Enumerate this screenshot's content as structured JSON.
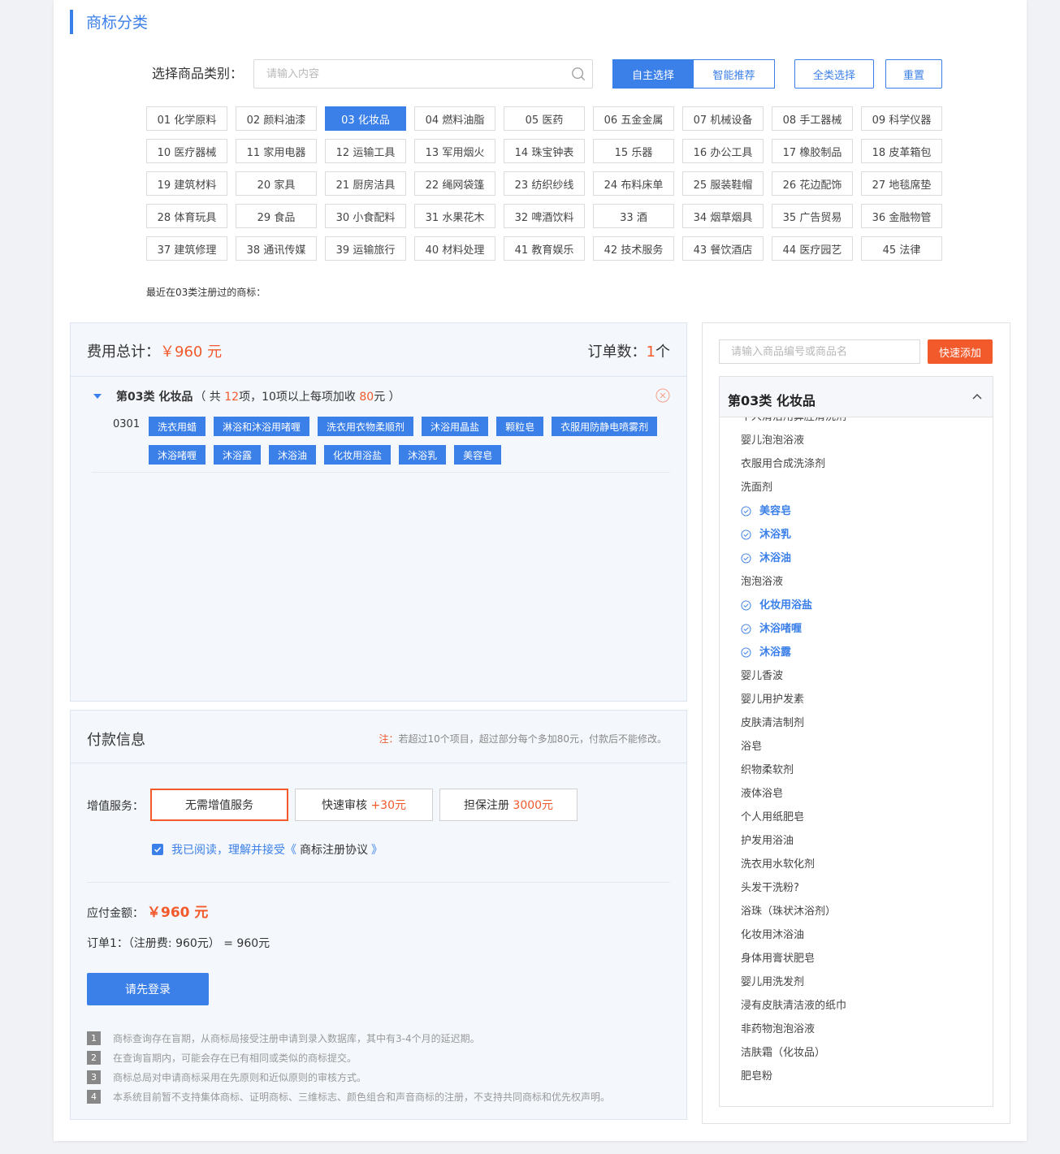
{
  "header": {
    "title": "商标分类"
  },
  "filter": {
    "label": "选择商品类别：",
    "search_placeholder": "请输入内容",
    "mode_manual": "自主选择",
    "mode_smart": "智能推荐",
    "select_all": "全类选择",
    "reset": "重置"
  },
  "categories": [
    "01 化学原料",
    "02 颜料油漆",
    "03 化妆品",
    "04 燃料油脂",
    "05 医药",
    "06 五金金属",
    "07 机械设备",
    "08 手工器械",
    "09 科学仪器",
    "10 医疗器械",
    "11 家用电器",
    "12 运输工具",
    "13 军用烟火",
    "14 珠宝钟表",
    "15 乐器",
    "16 办公工具",
    "17 橡胶制品",
    "18 皮革箱包",
    "19 建筑材料",
    "20 家具",
    "21 厨房洁具",
    "22 绳网袋篷",
    "23 纺织纱线",
    "24 布料床单",
    "25 服装鞋帽",
    "26 花边配饰",
    "27 地毯席垫",
    "28 体育玩具",
    "29 食品",
    "30 小食配料",
    "31 水果花木",
    "32 啤酒饮料",
    "33 酒",
    "34 烟草烟具",
    "35 广告贸易",
    "36 金融物管",
    "37 建筑修理",
    "38 通讯传媒",
    "39 运输旅行",
    "40 材料处理",
    "41 教育娱乐",
    "42 技术服务",
    "43 餐饮酒店",
    "44 医疗园艺",
    "45 法律"
  ],
  "active_category": "03 化妆品",
  "recent_text": "最近在03类注册过的商标：",
  "cost": {
    "total_label": "费用总计：",
    "total_value": "￥960 元",
    "orders_label": "订单数：",
    "orders_value": "1",
    "orders_unit": "个",
    "group_title": "第03类 化妆品",
    "group_note_a": "（ 共 ",
    "group_count": "12",
    "group_note_b": "项，10项以上每项加收 ",
    "group_extra": "80",
    "group_note_c": "元 ）",
    "code": "0301",
    "tags": [
      "洗衣用蜡",
      "淋浴和沐浴用啫喱",
      "洗衣用衣物柔顺剂",
      "沐浴用晶盐",
      "颗粒皂",
      "衣服用防静电喷雾剂",
      "沐浴啫喱",
      "沐浴露",
      "沐浴油",
      "化妆用浴盐",
      "沐浴乳",
      "美容皂"
    ]
  },
  "payment": {
    "title": "付款信息",
    "note_prefix": "注：",
    "note": "若超过10个项目，超过部分每个多加80元，付款后不能修改。",
    "vas_label": "增值服务：",
    "vas_none": "无需增值服务",
    "vas_fast": "快速审核",
    "vas_fast_price": "+30元",
    "vas_guarantee": "担保注册",
    "vas_guarantee_price": "3000元",
    "agree_text": "我已阅读，理解并接受《",
    "agree_link": "商标注册协议",
    "agree_end": "》",
    "due_label": "应付金额：",
    "due_value": "￥960 元",
    "order_line": "订单1：（注册费: 960元） = 960元",
    "login_button": "请先登录",
    "notes": [
      {
        "num": "1",
        "text": "商标查询存在盲期，从商标局接受注册申请到录入数据库，其中有3-4个月的延迟期。"
      },
      {
        "num": "2",
        "text": "在查询盲期内，可能会存在已有相同或类似的商标提交。"
      },
      {
        "num": "3",
        "text": "商标总局对申请商标采用在先原则和近似原则的审核方式。"
      },
      {
        "num": "4",
        "text": "本系统目前暂不支持集体商标、证明商标、三维标志、颜色组合和声音商标的注册，不支持共同商标和优先权声明。"
      }
    ]
  },
  "side": {
    "quick_placeholder": "请输入商品编号或商品名",
    "quick_button": "快速添加",
    "list_title": "第03类 化妆品",
    "items": [
      {
        "text": "个人清洁用鼻腔清洗剂",
        "selected": false
      },
      {
        "text": "婴儿泡泡浴液",
        "selected": false
      },
      {
        "text": "衣服用合成洗涤剂",
        "selected": false
      },
      {
        "text": "洗面剂",
        "selected": false
      },
      {
        "text": "美容皂",
        "selected": true
      },
      {
        "text": "沐浴乳",
        "selected": true
      },
      {
        "text": "沐浴油",
        "selected": true
      },
      {
        "text": "泡泡浴液",
        "selected": false
      },
      {
        "text": "化妆用浴盐",
        "selected": true
      },
      {
        "text": "沐浴啫喱",
        "selected": true
      },
      {
        "text": "沐浴露",
        "selected": true
      },
      {
        "text": "婴儿香波",
        "selected": false
      },
      {
        "text": "婴儿用护发素",
        "selected": false
      },
      {
        "text": "皮肤清洁制剂",
        "selected": false
      },
      {
        "text": "浴皂",
        "selected": false
      },
      {
        "text": "织物柔软剂",
        "selected": false
      },
      {
        "text": "液体浴皂",
        "selected": false
      },
      {
        "text": "个人用纸肥皂",
        "selected": false
      },
      {
        "text": "护发用浴油",
        "selected": false
      },
      {
        "text": "洗衣用水软化剂",
        "selected": false
      },
      {
        "text": "头发干洗粉?",
        "selected": false
      },
      {
        "text": "浴珠（珠状沐浴剂）",
        "selected": false
      },
      {
        "text": "化妆用沐浴油",
        "selected": false
      },
      {
        "text": "身体用膏状肥皂",
        "selected": false
      },
      {
        "text": "婴儿用洗发剂",
        "selected": false
      },
      {
        "text": "浸有皮肤清洁液的纸巾",
        "selected": false
      },
      {
        "text": "非药物泡泡浴液",
        "selected": false
      },
      {
        "text": "洁肤霜（化妆品）",
        "selected": false
      },
      {
        "text": "肥皂粉",
        "selected": false
      }
    ]
  },
  "colors": {
    "accent": "#3b7fe8",
    "highlight": "#f25a2c"
  }
}
